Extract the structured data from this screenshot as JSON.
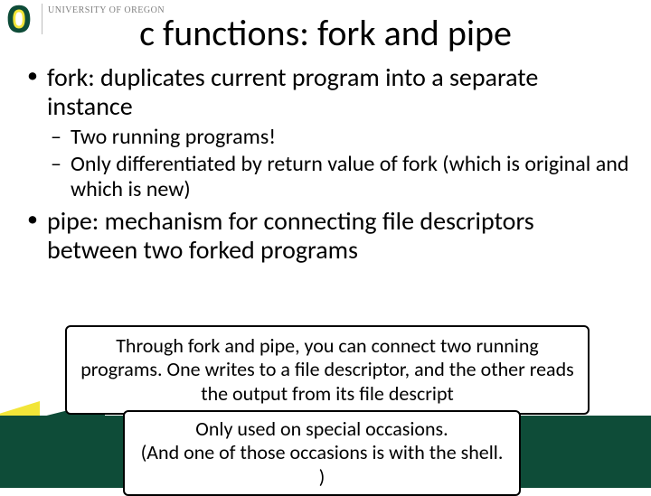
{
  "logo": {
    "letter": "O",
    "text1": "UNIVERSITY OF OREGON"
  },
  "title": "c functions: fork and pipe",
  "bullets": {
    "item1": "fork: duplicates current program into a separate instance",
    "sub1": "Two running programs!",
    "sub2": "Only differentiated by return value of fork (which is original and which is new)",
    "item2": "pipe: mechanism for connecting file descriptors between two forked programs"
  },
  "callout1": "Through fork and pipe, you can connect two running programs.  One writes to a file descriptor, and the other reads the output from its file descript",
  "callout2": "Only used on special occasions.\n(And one of those occasions is with the shell. )",
  "colors": {
    "brand_green": "#0e4c38",
    "brand_yellow": "#f2e538"
  }
}
